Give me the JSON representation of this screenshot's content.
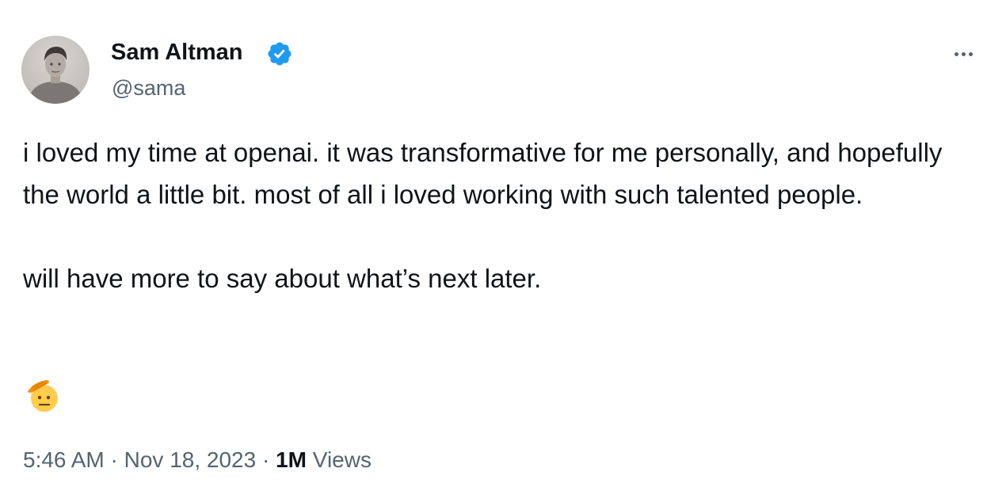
{
  "tweet": {
    "author": {
      "display_name": "Sam Altman",
      "handle": "@sama",
      "verified": true,
      "verified_color": "#1d9bf0",
      "avatar_icon": "profile-photo"
    },
    "menu_icon": "more-horizontal-icon",
    "text_paragraphs": [
      "i loved my time at openai. it was transformative for me personally, and hopefully the world a little bit. most of all i loved working with such talented people.",
      "will have more to say about what’s next later."
    ],
    "emoji": "saluting-face",
    "meta": {
      "time": "5:46 AM",
      "separator": "·",
      "date": "Nov 18, 2023",
      "views_count": "1M",
      "views_label": "Views"
    },
    "colors": {
      "text_primary": "#0f1419",
      "text_secondary": "#536471",
      "background": "#ffffff"
    }
  }
}
